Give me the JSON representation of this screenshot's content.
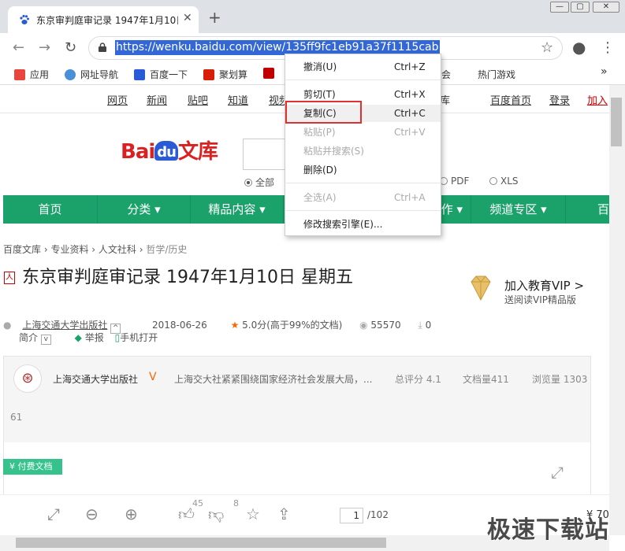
{
  "tab": {
    "title": "东京审判庭审记录 1947年1月10日 星期五",
    "close": "✕",
    "new": "+"
  },
  "window": {
    "minimize": "—",
    "maximize": "▢",
    "close": "✕"
  },
  "nav": {
    "back": "←",
    "forward": "→",
    "reload": "↻",
    "star": "☆",
    "profile": "●",
    "menu": "⋮"
  },
  "address": {
    "url": "https://wenku.baidu.com/view/135ff9fc1eb91a37f1115cab"
  },
  "bookmarks": [
    {
      "label": "应用",
      "color": "#e8453c"
    },
    {
      "label": "网址导航",
      "color": "#4a90d9"
    },
    {
      "label": "百度一下",
      "color": "#2a5bd7"
    },
    {
      "label": "聚划算",
      "color": "#d81e06"
    },
    {
      "label": "",
      "color": "#c00000"
    },
    {
      "label": "会",
      "color": ""
    },
    {
      "label": "热门游戏",
      "color": "#e0a070"
    }
  ],
  "bookmarks_more": "»",
  "topnav": [
    "网页",
    "新闻",
    "贴吧",
    "知道",
    "视频",
    "库",
    "百度首页",
    "登录",
    "加入"
  ],
  "logo": {
    "bai": "Bai",
    "du": "du",
    "wenku": "文库"
  },
  "radios": {
    "all": "全部",
    "pdf": "PDF",
    "xls": "XLS"
  },
  "greennav": [
    {
      "label": "首页"
    },
    {
      "label": "分类 ▾"
    },
    {
      "label": "精品内容 ▾"
    },
    {
      "label": "作 ▾"
    },
    {
      "label": "频道专区 ▾"
    },
    {
      "label": "百"
    }
  ],
  "breadcrumbs": [
    "百度文库",
    "专业资料",
    "人文社科",
    "哲学/历史"
  ],
  "doc": {
    "title": "东京审判庭审记录 1947年1月10日 星期五",
    "publisher": "上海交通大学出版社",
    "date": "2018-06-26",
    "rating": "5.0分(高于99%的文档)",
    "views": "55570",
    "downloads": "0",
    "intro": "简介",
    "report": "举报",
    "mobile": "手机打开"
  },
  "vip": {
    "title": "加入教育VIP >",
    "subtitle": "送阅读VIP精品版"
  },
  "pubcard": {
    "name": "上海交通大学出版社",
    "desc": "上海交大社紧紧围绕国家经济社会发展大局，...",
    "score": "总评分 4.1",
    "docs": "文档量411",
    "browse": "浏览量 1303",
    "browse2": "61"
  },
  "paid_tag": "付费文档",
  "bottom": {
    "likes": "45",
    "dislikes": "8",
    "page": "1",
    "total": "/102",
    "price": "¥ 70"
  },
  "context_menu": [
    {
      "label": "撤消(U)",
      "shortcut": "Ctrl+Z",
      "disabled": false
    },
    {
      "label": "剪切(T)",
      "shortcut": "Ctrl+X",
      "disabled": false
    },
    {
      "label": "复制(C)",
      "shortcut": "Ctrl+C",
      "disabled": false
    },
    {
      "label": "粘贴(P)",
      "shortcut": "Ctrl+V",
      "disabled": true
    },
    {
      "label": "粘贴并搜索(S)",
      "shortcut": "",
      "disabled": true
    },
    {
      "label": "删除(D)",
      "shortcut": "",
      "disabled": false
    },
    {
      "label": "全选(A)",
      "shortcut": "Ctrl+A",
      "disabled": true
    },
    {
      "label": "修改搜索引擎(E)...",
      "shortcut": "",
      "disabled": false
    }
  ],
  "watermark": "极速下载站",
  "colors": {
    "accent": "#1ba26b",
    "selection": "#3367d6",
    "highlight": "#e03030"
  }
}
